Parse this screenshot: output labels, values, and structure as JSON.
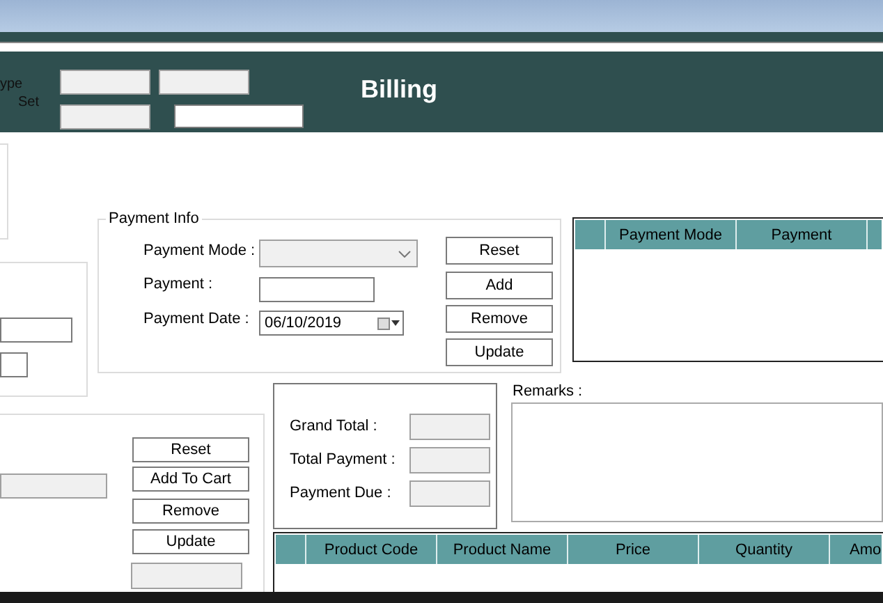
{
  "header": {
    "title": "Billing",
    "labels": [
      "ype",
      "Set"
    ],
    "fields": [
      {
        "disabled": true
      },
      {
        "disabled": true
      },
      {
        "disabled": true
      },
      {
        "disabled": false
      }
    ]
  },
  "left_fields": [
    {
      "disabled": false
    },
    {
      "disabled": false
    }
  ],
  "payment_info": {
    "title": "Payment Info",
    "mode": {
      "label": "Payment Mode :",
      "disabled": true
    },
    "payment": {
      "label": "Payment :",
      "disabled": false
    },
    "date": {
      "label": "Payment Date :",
      "value": "06/10/2019"
    },
    "buttons": [
      "Reset",
      "Add",
      "Remove",
      "Update"
    ]
  },
  "payments_table": {
    "columns": [
      "Payment Mode",
      "Payment"
    ]
  },
  "cart": {
    "field": {
      "disabled": true
    },
    "buttons": [
      "Reset",
      "Add To Cart",
      "Remove",
      "Update"
    ],
    "bottom_field": {
      "disabled": true
    }
  },
  "totals": [
    {
      "label": "Grand Total :",
      "disabled": true
    },
    {
      "label": "Total Payment :",
      "disabled": true
    },
    {
      "label": "Payment Due :",
      "disabled": true
    }
  ],
  "remarks": {
    "label": "Remarks :"
  },
  "products_table": {
    "columns": [
      "Product Code",
      "Product Name",
      "Price",
      "Quantity",
      "Amo"
    ]
  }
}
